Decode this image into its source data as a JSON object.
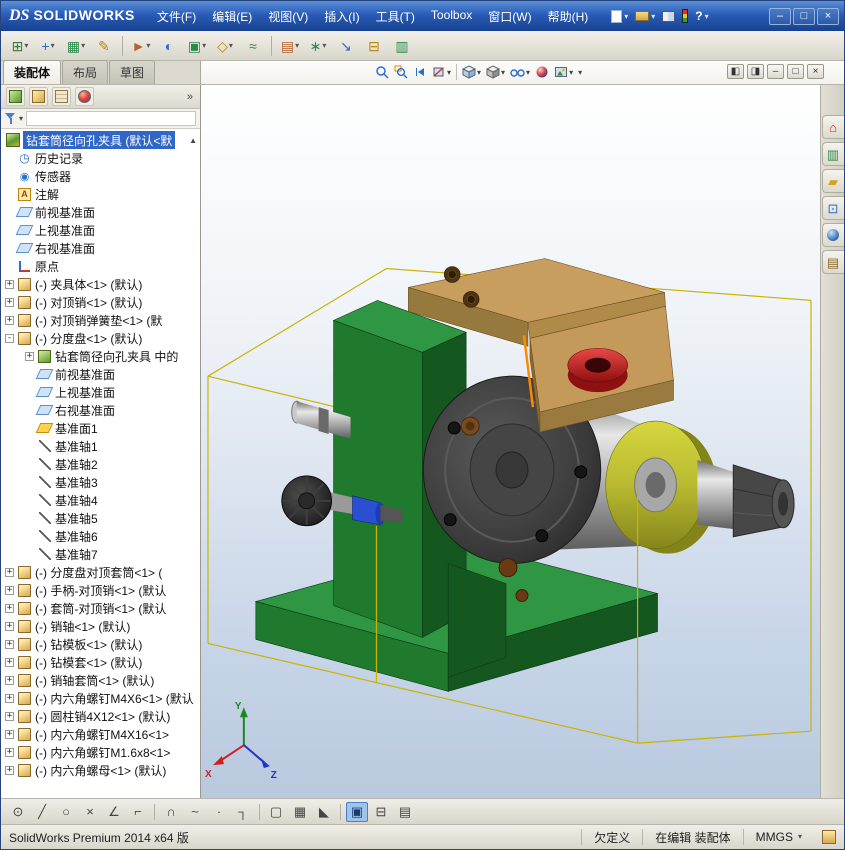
{
  "titlebar": {
    "logo_mark": "DS",
    "logo_text": "SOLIDWORKS",
    "menus": [
      {
        "label": "文件(F)"
      },
      {
        "label": "编辑(E)"
      },
      {
        "label": "视图(V)"
      },
      {
        "label": "插入(I)"
      },
      {
        "label": "工具(T)"
      },
      {
        "label": "Toolbox"
      },
      {
        "label": "窗口(W)"
      },
      {
        "label": "帮助(H)"
      }
    ],
    "controls": {
      "minimize": "–",
      "maximize": "□",
      "close": "×",
      "help": "?"
    }
  },
  "glyphs": {
    "caret": "▾",
    "chevrons": "»",
    "scroll_up": "▲"
  },
  "toolbar": {
    "items": [
      {
        "name": "insert-components-button",
        "g": "⊞",
        "c": "#3a7a3a",
        "dd": "▾",
        "cls": ""
      },
      {
        "name": "mate-button",
        "g": "+",
        "c": "#2a6fd0",
        "dd": "▾",
        "cls": ""
      },
      {
        "name": "linear-component-pattern-button",
        "g": "▦",
        "c": "#2a8a4a",
        "dd": "▾",
        "cls": ""
      },
      {
        "name": "smart-fasteners-button",
        "g": "✎",
        "c": "#b8860b",
        "dd": "",
        "cls": ""
      },
      {
        "name": "separator",
        "g": "",
        "c": "",
        "dd": "",
        "cls": "sep"
      },
      {
        "name": "move-component-button",
        "g": "►",
        "c": "#b8602a",
        "dd": "▾",
        "cls": ""
      },
      {
        "name": "show-hidden-components-button",
        "g": "◐",
        "c": "#2a6fd0",
        "dd": "",
        "cls": ""
      },
      {
        "name": "assembly-features-button",
        "g": "▣",
        "c": "#2a8a4a",
        "dd": "▾",
        "cls": ""
      },
      {
        "name": "reference-geometry-button",
        "g": "◇",
        "c": "#b8860b",
        "dd": "▾",
        "cls": ""
      },
      {
        "name": "new-motion-study-button",
        "g": "≈",
        "c": "#2a8a4a",
        "dd": "",
        "cls": ""
      },
      {
        "name": "separator",
        "g": "",
        "c": "",
        "dd": "",
        "cls": "sep"
      },
      {
        "name": "bill-of-materials-button",
        "g": "▤",
        "c": "#b8602a",
        "dd": "▾",
        "cls": ""
      },
      {
        "name": "exploded-view-button",
        "g": "∗",
        "c": "#2a8a4a",
        "dd": "▾",
        "cls": ""
      },
      {
        "name": "interference-detection-button",
        "g": "↘",
        "c": "#2a6fd0",
        "dd": "",
        "cls": ""
      },
      {
        "name": "measure-button",
        "g": "⊟",
        "c": "#b8860b",
        "dd": "",
        "cls": ""
      },
      {
        "name": "mass-properties-button",
        "g": "▥",
        "c": "#2a8a4a",
        "dd": "",
        "cls": ""
      }
    ]
  },
  "tabs": {
    "items": [
      {
        "label": "装配体",
        "cls": "active"
      },
      {
        "label": "布局",
        "cls": ""
      },
      {
        "label": "草图",
        "cls": ""
      }
    ]
  },
  "docwin": {
    "buttons": [
      {
        "name": "pane-left-button",
        "g": "◧"
      },
      {
        "name": "pane-right-button",
        "g": "◨"
      },
      {
        "name": "doc-minimize-button",
        "g": "–"
      },
      {
        "name": "doc-restore-button",
        "g": "□"
      },
      {
        "name": "doc-close-button",
        "g": "×"
      }
    ]
  },
  "panel": {
    "root_label": "钻套筒径向孔夹具 (默认<默",
    "tree": [
      {
        "cls": "ind0",
        "exp": "",
        "icon": "hist",
        "label": "历史记录"
      },
      {
        "cls": "ind0",
        "exp": "",
        "icon": "sens",
        "label": "传感器"
      },
      {
        "cls": "ind0",
        "exp": "",
        "icon": "note",
        "label": "注解"
      },
      {
        "cls": "ind0",
        "exp": "",
        "icon": "plane",
        "label": "前视基准面"
      },
      {
        "cls": "ind0",
        "exp": "",
        "icon": "plane",
        "label": "上视基准面"
      },
      {
        "cls": "ind0",
        "exp": "",
        "icon": "plane",
        "label": "右视基准面"
      },
      {
        "cls": "ind0",
        "exp": "",
        "icon": "origin",
        "label": "原点"
      },
      {
        "cls": "ind0",
        "exp": "+",
        "icon": "comp",
        "label": "(-) 夹具体<1> (默认)"
      },
      {
        "cls": "ind0",
        "exp": "+",
        "icon": "comp",
        "label": "(-) 对顶销<1> (默认)"
      },
      {
        "cls": "ind0",
        "exp": "+",
        "icon": "comp",
        "label": "(-) 对顶销弹簧垫<1> (默"
      },
      {
        "cls": "ind0",
        "exp": "-",
        "icon": "comp",
        "label": "(-) 分度盘<1> (默认)"
      },
      {
        "cls": "ind1",
        "exp": "+",
        "icon": "ref",
        "label": "钻套筒径向孔夹具 中的"
      },
      {
        "cls": "ind1",
        "exp": "",
        "icon": "plane",
        "label": "前视基准面"
      },
      {
        "cls": "ind1",
        "exp": "",
        "icon": "plane",
        "label": "上视基准面"
      },
      {
        "cls": "ind1",
        "exp": "",
        "icon": "plane",
        "label": "右视基准面"
      },
      {
        "cls": "ind1",
        "exp": "",
        "icon": "planeSel",
        "label": "基准面1"
      },
      {
        "cls": "ind1",
        "exp": "",
        "icon": "axis",
        "label": "基准轴1"
      },
      {
        "cls": "ind1",
        "exp": "",
        "icon": "axis",
        "label": "基准轴2"
      },
      {
        "cls": "ind1",
        "exp": "",
        "icon": "axis",
        "label": "基准轴3"
      },
      {
        "cls": "ind1",
        "exp": "",
        "icon": "axis",
        "label": "基准轴4"
      },
      {
        "cls": "ind1",
        "exp": "",
        "icon": "axis",
        "label": "基准轴5"
      },
      {
        "cls": "ind1",
        "exp": "",
        "icon": "axis",
        "label": "基准轴6"
      },
      {
        "cls": "ind1",
        "exp": "",
        "icon": "axis",
        "label": "基准轴7"
      },
      {
        "cls": "ind0",
        "exp": "+",
        "icon": "comp",
        "label": "(-) 分度盘对顶套筒<1> ("
      },
      {
        "cls": "ind0",
        "exp": "+",
        "icon": "comp",
        "label": "(-) 手柄-对顶销<1> (默认"
      },
      {
        "cls": "ind0",
        "exp": "+",
        "icon": "comp",
        "label": "(-) 套筒-对顶销<1> (默认"
      },
      {
        "cls": "ind0",
        "exp": "+",
        "icon": "comp",
        "label": "(-) 销轴<1> (默认)"
      },
      {
        "cls": "ind0",
        "exp": "+",
        "icon": "comp",
        "label": "(-) 钻模板<1> (默认)"
      },
      {
        "cls": "ind0",
        "exp": "+",
        "icon": "comp",
        "label": "(-) 钻模套<1> (默认)"
      },
      {
        "cls": "ind0",
        "exp": "+",
        "icon": "comp",
        "label": "(-) 销轴套筒<1> (默认)"
      },
      {
        "cls": "ind0",
        "exp": "+",
        "icon": "comp",
        "label": "(-) 内六角螺钉M4X6<1> (默认"
      },
      {
        "cls": "ind0",
        "exp": "+",
        "icon": "comp",
        "label": "(-) 圆柱销4X12<1> (默认)"
      },
      {
        "cls": "ind0",
        "exp": "+",
        "icon": "comp",
        "label": "(-) 内六角螺钉M4X16<1>"
      },
      {
        "cls": "ind0",
        "exp": "+",
        "icon": "comp",
        "label": "(-) 内六角螺钉M1.6x8<1>"
      },
      {
        "cls": "ind0",
        "exp": "+",
        "icon": "comp",
        "label": "(-) 内六角螺母<1> (默认)"
      }
    ]
  },
  "taskpane": {
    "items": [
      {
        "name": "solidworks-resources-icon",
        "g": "⌂",
        "c": "#cc2222",
        "cls": ""
      },
      {
        "name": "design-library-icon",
        "g": "▥",
        "c": "#2a8a4a",
        "cls": ""
      },
      {
        "name": "file-explorer-icon",
        "g": "▰",
        "c": "#d8a020",
        "cls": ""
      },
      {
        "name": "view-palette-icon",
        "g": "⊡",
        "c": "#2a6fd0",
        "cls": ""
      },
      {
        "name": "appearances-icon",
        "g": "",
        "c": "",
        "cls": "sphere"
      },
      {
        "name": "custom-properties-icon",
        "g": "▤",
        "c": "#8a6a2a",
        "cls": ""
      }
    ]
  },
  "model": {
    "colors": {
      "green": "#1f7a2e",
      "green_light": "#2f9743",
      "green_dark": "#14571f",
      "steel": "#b5b5b5",
      "disc": "#3c3c3c",
      "yellow": "#b9ba30",
      "tan": "#c89e5e",
      "tan_dark": "#96793c",
      "red": "#cf2323",
      "box": "#c9b400",
      "highlight": "#ff8a00",
      "knob": "#1c1c1c",
      "blue_part": "#2a4fd0"
    },
    "triad": {
      "x": "X",
      "y": "Y",
      "z": "Z"
    }
  },
  "bottom": {
    "items": [
      {
        "name": "smart-dimension-icon",
        "g": "⊙",
        "cls": ""
      },
      {
        "name": "line-icon",
        "g": "╱",
        "cls": ""
      },
      {
        "name": "circle-icon",
        "g": "○",
        "cls": ""
      },
      {
        "name": "trim-entities-icon",
        "g": "×",
        "cls": ""
      },
      {
        "name": "sketch-fillet-icon",
        "g": "∠",
        "cls": ""
      },
      {
        "name": "centerline-icon",
        "g": "⌐",
        "cls": ""
      },
      {
        "name": "separator",
        "g": "",
        "cls": "sep"
      },
      {
        "name": "arc-icon",
        "g": "∩",
        "cls": ""
      },
      {
        "name": "spline-icon",
        "g": "~",
        "cls": ""
      },
      {
        "name": "point-icon",
        "g": "·",
        "cls": ""
      },
      {
        "name": "corner-rectangle-icon",
        "g": "┐",
        "cls": ""
      },
      {
        "name": "separator",
        "g": "",
        "cls": "sep"
      },
      {
        "name": "slot-icon",
        "g": "▢",
        "cls": ""
      },
      {
        "name": "linear-pattern-icon",
        "g": "▦",
        "cls": ""
      },
      {
        "name": "convert-entities-icon",
        "g": "◣",
        "cls": ""
      },
      {
        "name": "separator",
        "g": "",
        "cls": "sep"
      },
      {
        "name": "shaded-sketch-contours-icon",
        "g": "▣",
        "cls": "sel"
      },
      {
        "name": "split-entities-icon",
        "g": "⊟",
        "cls": ""
      },
      {
        "name": "grid-snap-icon",
        "g": "▤",
        "cls": ""
      }
    ]
  },
  "status": {
    "left": "SolidWorks Premium 2014 x64 版",
    "state": "欠定义",
    "editing": "在编辑 装配体",
    "units": "MMGS"
  }
}
